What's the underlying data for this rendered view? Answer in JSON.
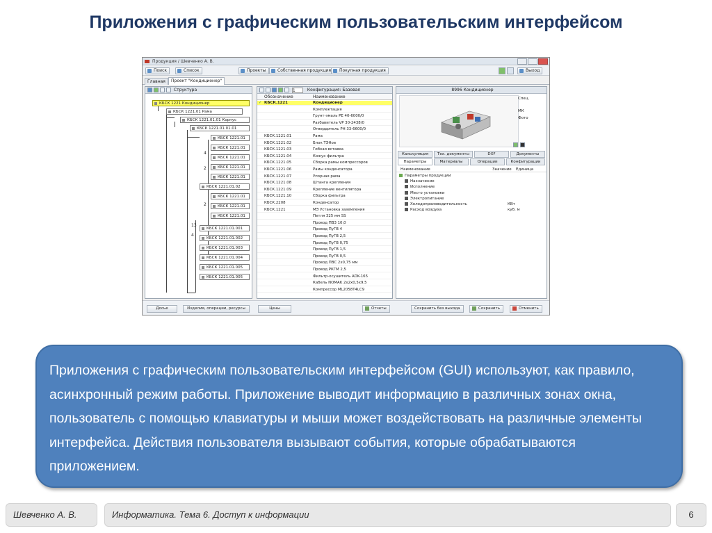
{
  "slide": {
    "title": "Приложения с графическим пользовательским интерфейсом",
    "body": "Приложения с графическим пользовательским интерфейсом (GUI) используют, как правило, асинхронный режим работы. Приложение выводит информацию в различных зонах окна, пользователь с помощью клавиатуры и мыши может воздействовать на различные элементы интерфейса. Действия пользователя вызывают события, которые обрабатываются приложением.",
    "footer_author": "Шевченко А. В.",
    "footer_topic": "Информатика. Тема 6. Доступ к информации",
    "page_number": "6"
  },
  "app": {
    "window_title": "Продукция / Шевченко А. В.",
    "toolbar": {
      "search": "Поиск",
      "list": "Список",
      "projects": "Проекты",
      "own_products": "Собственная продукция",
      "purchased_products": "Покупная продукция",
      "exit": "Выход"
    },
    "tabs": [
      "Главная",
      "Проект \"Кондиционер\""
    ],
    "tree": {
      "header": "Структура",
      "nodes": [
        "КБСК 1221 Кондиционер",
        "КБСК 1221.01 Рама",
        "КБСК 1221.01.01 Корпус",
        "КБСК 1221.01.01.01",
        "КБСК 1221.01",
        "КБСК 1221.01",
        "КБСК 1221.01",
        "КБСК 1221.01",
        "КБСК 1221.01",
        "КБСК 1221.01.02",
        "КБСК 1221.01",
        "КБСК 1221.01",
        "КБСК 1221.01",
        "КБСК 1221.01.001",
        "КБСК 1221.01.002",
        "КБСК 1221.01.003",
        "КБСК 1221.01.004",
        "КБСК 1221.01.005",
        "КБСК 1221.01.005"
      ],
      "numbers": [
        "4",
        "2",
        "2",
        "13",
        "4"
      ]
    },
    "list": {
      "page_input": "1",
      "config_label": "Конфигурация: Базовая",
      "col_designation": "Обозначение",
      "col_name": "Наименование",
      "rows": [
        {
          "d": "КБСК.1221",
          "n": "Кондиционер"
        },
        {
          "d": "",
          "n": "Комплектация"
        },
        {
          "d": "",
          "n": "Грунт-эмаль РЕ 40-6000/0"
        },
        {
          "d": "",
          "n": "Разбавитель VP 30-2438/0"
        },
        {
          "d": "",
          "n": "Отвердитель РН 33-6600/0"
        },
        {
          "d": "КБСК.1221.01",
          "n": "Рама"
        },
        {
          "d": "КБСК.1221.02",
          "n": "Блок ТЭНов"
        },
        {
          "d": "КБСК.1221.03",
          "n": "Гибкая вставка"
        },
        {
          "d": "КБСК.1221.04",
          "n": "Кожух фильтра"
        },
        {
          "d": "КБСК.1221.05",
          "n": "Сборка рамы компрессоров"
        },
        {
          "d": "КБСК.1221.06",
          "n": "Рамы конденсатора"
        },
        {
          "d": "КБСК.1221.07",
          "n": "Упорная рама"
        },
        {
          "d": "КБСК.1221.08",
          "n": "Штанга крепления"
        },
        {
          "d": "КБСК.1221.09",
          "n": "Крепление вентилятора"
        },
        {
          "d": "КБСК.1221.10",
          "n": "Сборка фильтра"
        },
        {
          "d": "КБСК.2208",
          "n": "Конденсатор"
        },
        {
          "d": "КБСК.1221",
          "n": "МЭ Установка заземления"
        },
        {
          "d": "",
          "n": "Петля 325 мм SS"
        },
        {
          "d": "",
          "n": "Провод ПВ3 10,0"
        },
        {
          "d": "",
          "n": "Провод ПуГВ 4"
        },
        {
          "d": "",
          "n": "Провод ПуГВ 2,5"
        },
        {
          "d": "",
          "n": "Провод ПуГВ 0,75"
        },
        {
          "d": "",
          "n": "Провод ПуГВ 1,5"
        },
        {
          "d": "",
          "n": "Провод ПуГВ 0,5"
        },
        {
          "d": "",
          "n": "Провод ПВС 2х0,75 мм"
        },
        {
          "d": "",
          "n": "Провод РКГМ 2,5"
        },
        {
          "d": "",
          "n": "Фильтр-осушитель ADK-165"
        },
        {
          "d": "",
          "n": "Кабель NOMAK 2х2х0,5х9,5"
        },
        {
          "d": "",
          "n": "Компрессор ML2058T4LC9"
        }
      ]
    },
    "right": {
      "header": "8996 Кондиционер",
      "side_items": [
        "Спец.",
        "МК",
        "Фото"
      ],
      "tabs_row1": [
        "Калькуляция",
        "Тех. документы",
        "DXF",
        "Документы"
      ],
      "tabs_row2": [
        "Параметры",
        "Материалы",
        "Операции",
        "Конфигурации"
      ],
      "col_name": "Наименование",
      "col_value": "Значение",
      "col_unit": "Единица",
      "props": [
        {
          "n": "Параметры продукции",
          "v": "",
          "u": ""
        },
        {
          "n": "Назначение",
          "v": "",
          "u": ""
        },
        {
          "n": "Исполнение",
          "v": "",
          "u": ""
        },
        {
          "n": "Место установки",
          "v": "",
          "u": ""
        },
        {
          "n": "Электропитание",
          "v": "",
          "u": ""
        },
        {
          "n": "Холодопроизводительность",
          "v": "",
          "u": "КВт"
        },
        {
          "n": "Расход воздуха",
          "v": "",
          "u": "куб. м"
        }
      ]
    },
    "bottom": {
      "dossier": "Досье",
      "items": "Изделия, операции, ресурсы",
      "prices": "Цены",
      "reports": "Отчеты",
      "save_no_exit": "Сохранить без выхода",
      "save": "Сохранить",
      "cancel": "Отменить"
    }
  },
  "colors": {
    "title": "#1f3864",
    "box_fill": "#4f81bd",
    "selection": "#ffff66"
  }
}
